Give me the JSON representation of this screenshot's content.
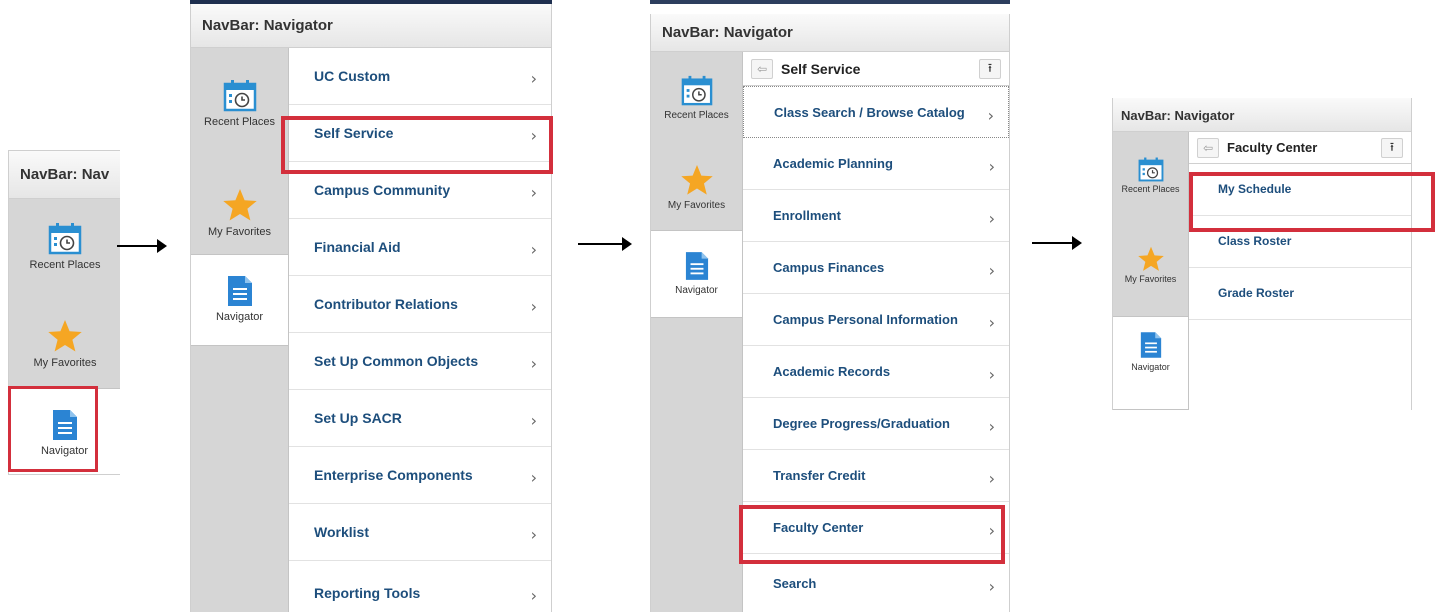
{
  "navbar_title": "NavBar: Navigator",
  "navbar_title_truncated": "NavBar: Nav",
  "tabs": {
    "recent": "Recent Places",
    "favorites": "My Favorites",
    "navigator": "Navigator"
  },
  "menu_root": [
    "UC Custom",
    "Self Service",
    "Campus Community",
    "Financial Aid",
    "Contributor Relations",
    "Set Up Common Objects",
    "Set Up SACR",
    "Enterprise Components",
    "Worklist",
    "Reporting Tools"
  ],
  "self_service": {
    "title": "Self Service",
    "items": [
      "Class Search / Browse Catalog",
      "Academic Planning",
      "Enrollment",
      "Campus Finances",
      "Campus Personal Information",
      "Academic Records",
      "Degree Progress/Graduation",
      "Transfer Credit",
      "Faculty Center",
      "Search"
    ]
  },
  "faculty_center": {
    "title": "Faculty Center",
    "items": [
      "My Schedule",
      "Class Roster",
      "Grade Roster"
    ]
  },
  "icons": {
    "chevron": "›",
    "back": "⇦",
    "top": "⭱"
  },
  "colors": {
    "highlight": "#d32f3c",
    "link": "#1d4e7c",
    "star": "#f5a623",
    "calendar": "#2a8fd1",
    "doc": "#2b84d3"
  }
}
